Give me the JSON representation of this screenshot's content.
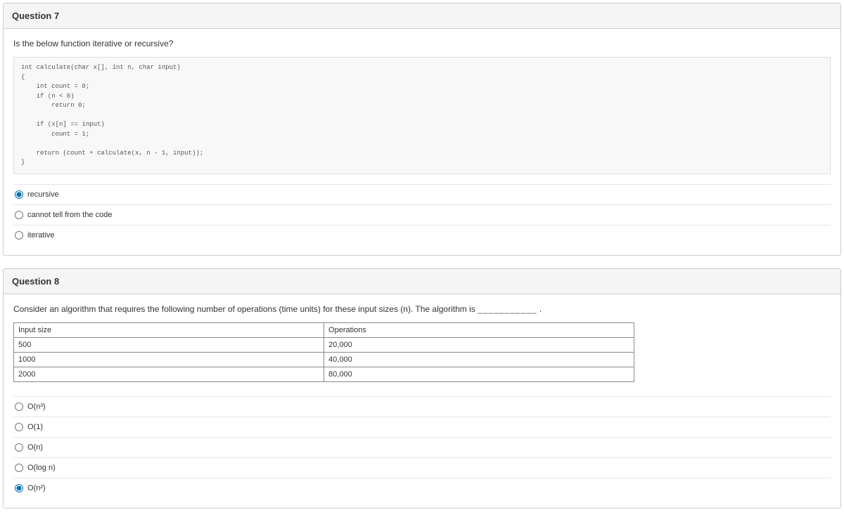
{
  "q7": {
    "title": "Question 7",
    "prompt": "Is the below function iterative or recursive?",
    "code": "int calculate(char x[], int n, char input)\n{\n    int count = 0;\n    if (n < 0)\n        return 0;\n\n    if (x[n] == input)\n        count = 1;\n\n    return (count + calculate(x, n - 1, input));\n}",
    "options": {
      "a": "recursive",
      "b": "cannot tell from the code",
      "c": "iterative"
    }
  },
  "q8": {
    "title": "Question 8",
    "prompt_prefix": "Consider an algorithm that requires the following number of operations (time units) for these input sizes (n).  The algorithm is ",
    "blank": "___________",
    "suffix": " .",
    "table": {
      "h1": "Input size",
      "h2": "Operations",
      "r1c1": "500",
      "r1c2": "20,000",
      "r2c1": "1000",
      "r2c2": "40,000",
      "r3c1": "2000",
      "r3c2": "80,000"
    },
    "options": {
      "a": "O(n³)",
      "b": "O(1)",
      "c": "O(n)",
      "d": "O(log n)",
      "e": "O(n²)"
    }
  }
}
